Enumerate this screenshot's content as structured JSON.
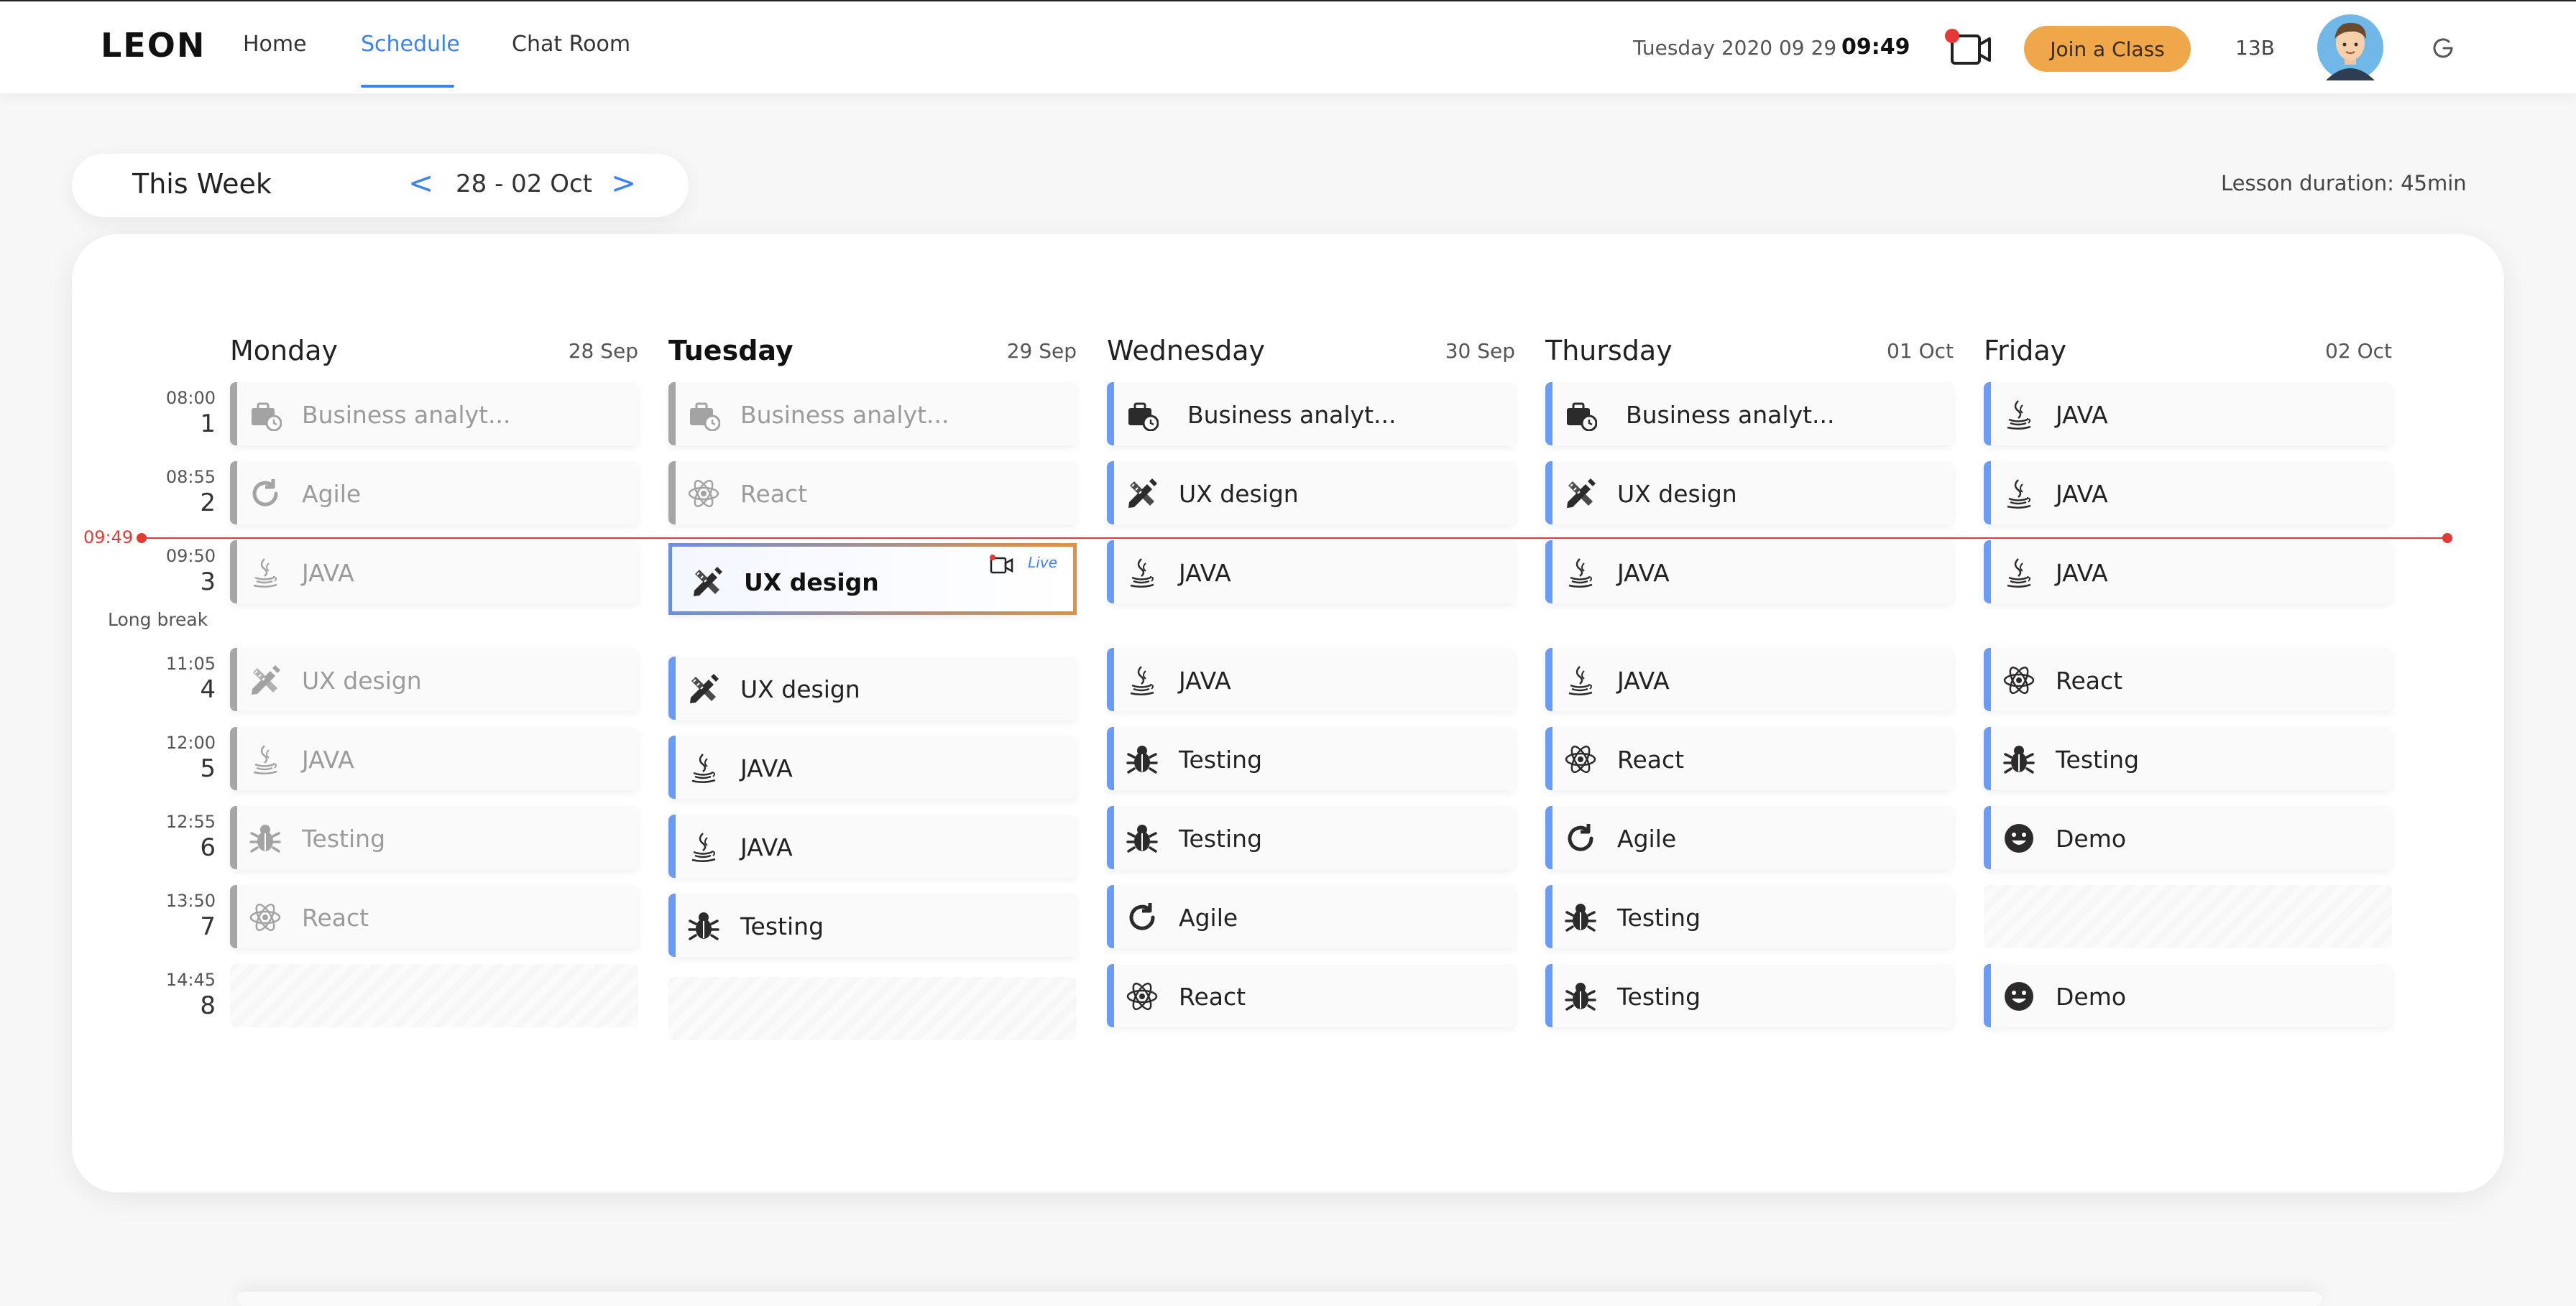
{
  "app": {
    "logo": "LEON"
  },
  "nav": {
    "home": "Home",
    "schedule": "Schedule",
    "chat": "Chat Room"
  },
  "header": {
    "date": "Tuesday 2020 09 29",
    "time": "09:49",
    "join_label": "Join a Class",
    "class_code": "13B"
  },
  "week": {
    "label": "This Week",
    "range": "28 - 02 Oct",
    "prev": "<",
    "next": ">",
    "lesson_duration": "Lesson duration: 45min"
  },
  "now_marker": "09:49",
  "long_break": "Long break",
  "periods": [
    {
      "time": "08:00",
      "num": "1"
    },
    {
      "time": "08:55",
      "num": "2"
    },
    {
      "time": "09:50",
      "num": "3"
    },
    {
      "time": "11:05",
      "num": "4"
    },
    {
      "time": "12:00",
      "num": "5"
    },
    {
      "time": "12:55",
      "num": "6"
    },
    {
      "time": "13:50",
      "num": "7"
    },
    {
      "time": "14:45",
      "num": "8"
    }
  ],
  "days": [
    {
      "name": "Monday",
      "date": "28 Sep",
      "lessons": [
        "Business analyt...",
        "Agile",
        "JAVA",
        "UX design",
        "JAVA",
        "Testing",
        "React",
        ""
      ]
    },
    {
      "name": "Tuesday",
      "date": "29 Sep",
      "lessons": [
        "Business analyt...",
        "React",
        "UX design",
        "UX design",
        "JAVA",
        "JAVA",
        "Testing",
        ""
      ],
      "live_tag": "Live"
    },
    {
      "name": "Wednesday",
      "date": "30 Sep",
      "lessons": [
        "Business analyt...",
        "UX design",
        "JAVA",
        "JAVA",
        "Testing",
        "Testing",
        "Agile",
        "React"
      ]
    },
    {
      "name": "Thursday",
      "date": "01 Oct",
      "lessons": [
        "Business analyt...",
        "UX design",
        "JAVA",
        "JAVA",
        "React",
        "Agile",
        "Testing",
        "Testing"
      ]
    },
    {
      "name": "Friday",
      "date": "02 Oct",
      "lessons": [
        "JAVA",
        "JAVA",
        "JAVA",
        "React",
        "Testing",
        "Demo",
        "",
        "Demo"
      ]
    }
  ],
  "icons": {
    "Business analyt...": "briefcase-clock-icon",
    "Agile": "refresh-icon",
    "JAVA": "java-icon",
    "UX design": "design-tools-icon",
    "Testing": "bug-icon",
    "React": "react-icon",
    "Demo": "smiley-icon"
  },
  "colors": {
    "accent": "#3b82f6",
    "join": "#f0a74a",
    "now_line": "#e53935",
    "future_bar": "#6b9cf5",
    "past_bar": "#a6a6a6"
  }
}
